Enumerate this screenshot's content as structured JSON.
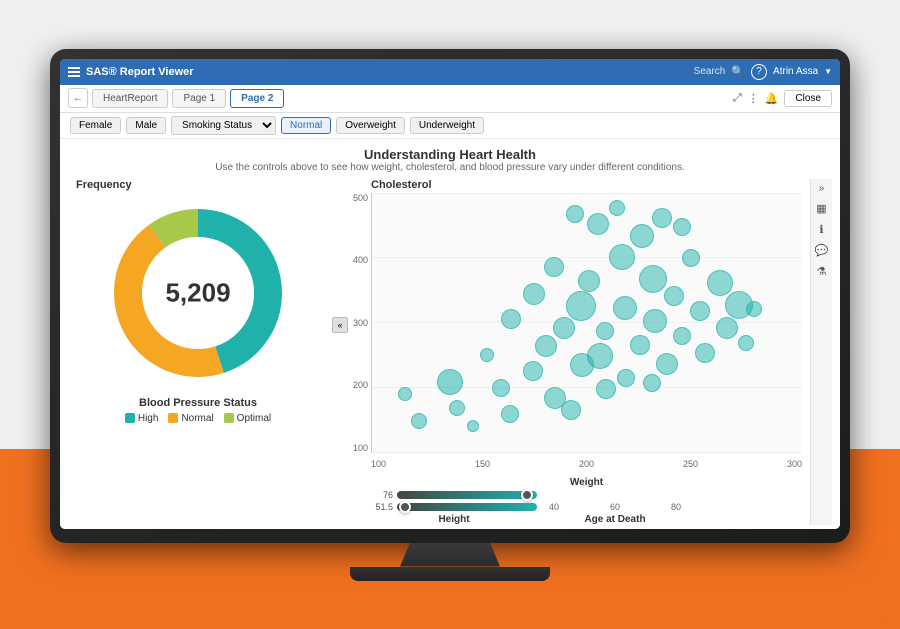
{
  "app": {
    "title": "SAS® Report Viewer",
    "search_placeholder": "Search"
  },
  "user": {
    "name": "Atrin Assa"
  },
  "toolbar": {
    "tabs": [
      "HeartReport",
      "Page 1",
      "Page 2"
    ],
    "active_tab": "Page 2",
    "close_label": "Close"
  },
  "filters": {
    "gender": [
      "Female",
      "Male"
    ],
    "weight_status_label": "Smoking Status",
    "status_options": [
      "Normal",
      "Overweight",
      "Underweight"
    ],
    "active_status": "Normal"
  },
  "donut_chart": {
    "title": "Blood Pressure Status",
    "value": "5,209",
    "frequency_label": "Frequency",
    "segments": [
      {
        "label": "High",
        "color": "#20b2aa",
        "percent": 45
      },
      {
        "label": "Normal",
        "color": "#f5a623",
        "percent": 45
      },
      {
        "label": "Optimal",
        "color": "#a8c84a",
        "percent": 10
      }
    ]
  },
  "scatter_chart": {
    "title": "Understanding Heart Health",
    "subtitle": "Use the controls above to see how weight, cholesterol, and blood pressure vary under different conditions.",
    "y_label": "Cholesterol",
    "x_label": "Weight",
    "y_ticks": [
      "500",
      "400",
      "300",
      "200",
      "100"
    ],
    "x_ticks": [
      "100",
      "150",
      "200",
      "250",
      "300"
    ]
  },
  "sliders": {
    "height": {
      "label": "Height",
      "values": [
        "76",
        "51.5"
      ],
      "axis_label": "Age at Death",
      "axis_ticks": [
        "40",
        "60",
        "80"
      ]
    }
  },
  "sidebar_icons": [
    "table-icon",
    "info-icon",
    "comment-icon",
    "filter-icon"
  ]
}
